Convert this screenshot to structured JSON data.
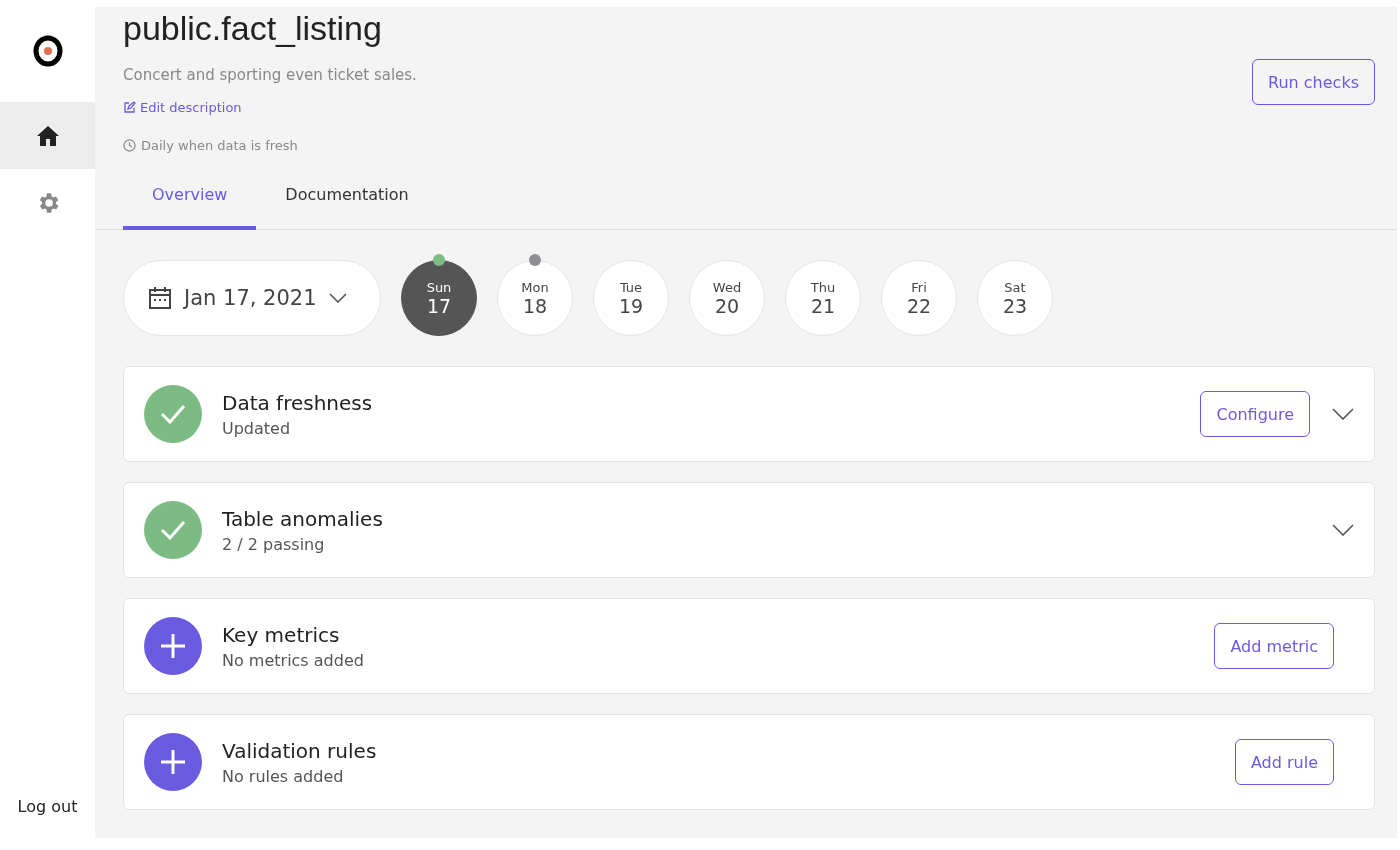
{
  "sidebar": {
    "nav": [
      {
        "kind": "home",
        "selected": true
      },
      {
        "kind": "settings",
        "selected": false
      }
    ],
    "logout": "Log out"
  },
  "header": {
    "title": "public.fact_listing",
    "description": "Concert and sporting even ticket sales.",
    "edit_link": "Edit description",
    "schedule": "Daily when data is fresh",
    "run_button": "Run checks"
  },
  "tabs": [
    {
      "label": "Overview",
      "selected": true
    },
    {
      "label": "Documentation",
      "selected": false
    }
  ],
  "date_picker": {
    "value": "Jan 17, 2021"
  },
  "days": [
    {
      "weekday": "Sun",
      "day": "17",
      "selected": true,
      "color": "#7dbb84"
    },
    {
      "weekday": "Mon",
      "day": "18",
      "selected": false,
      "color": "#8e8e93"
    },
    {
      "weekday": "Tue",
      "day": "19",
      "selected": false
    },
    {
      "weekday": "Wed",
      "day": "20",
      "selected": false
    },
    {
      "weekday": "Thu",
      "day": "21",
      "selected": false
    },
    {
      "weekday": "Fri",
      "day": "22",
      "selected": false
    },
    {
      "weekday": "Sat",
      "day": "23",
      "selected": false
    }
  ],
  "sections": [
    {
      "kind": "check",
      "title": "Data freshness",
      "subtitle": "Updated",
      "button": "Configure",
      "expandable": true
    },
    {
      "kind": "check",
      "title": "Table anomalies",
      "subtitle": "2 / 2 passing",
      "expandable": true
    },
    {
      "kind": "add",
      "title": "Key metrics",
      "subtitle": "No metrics added",
      "button": "Add metric",
      "expandable": false
    },
    {
      "kind": "add",
      "title": "Validation rules",
      "subtitle": "No rules added",
      "button": "Add rule",
      "expandable": false
    }
  ]
}
